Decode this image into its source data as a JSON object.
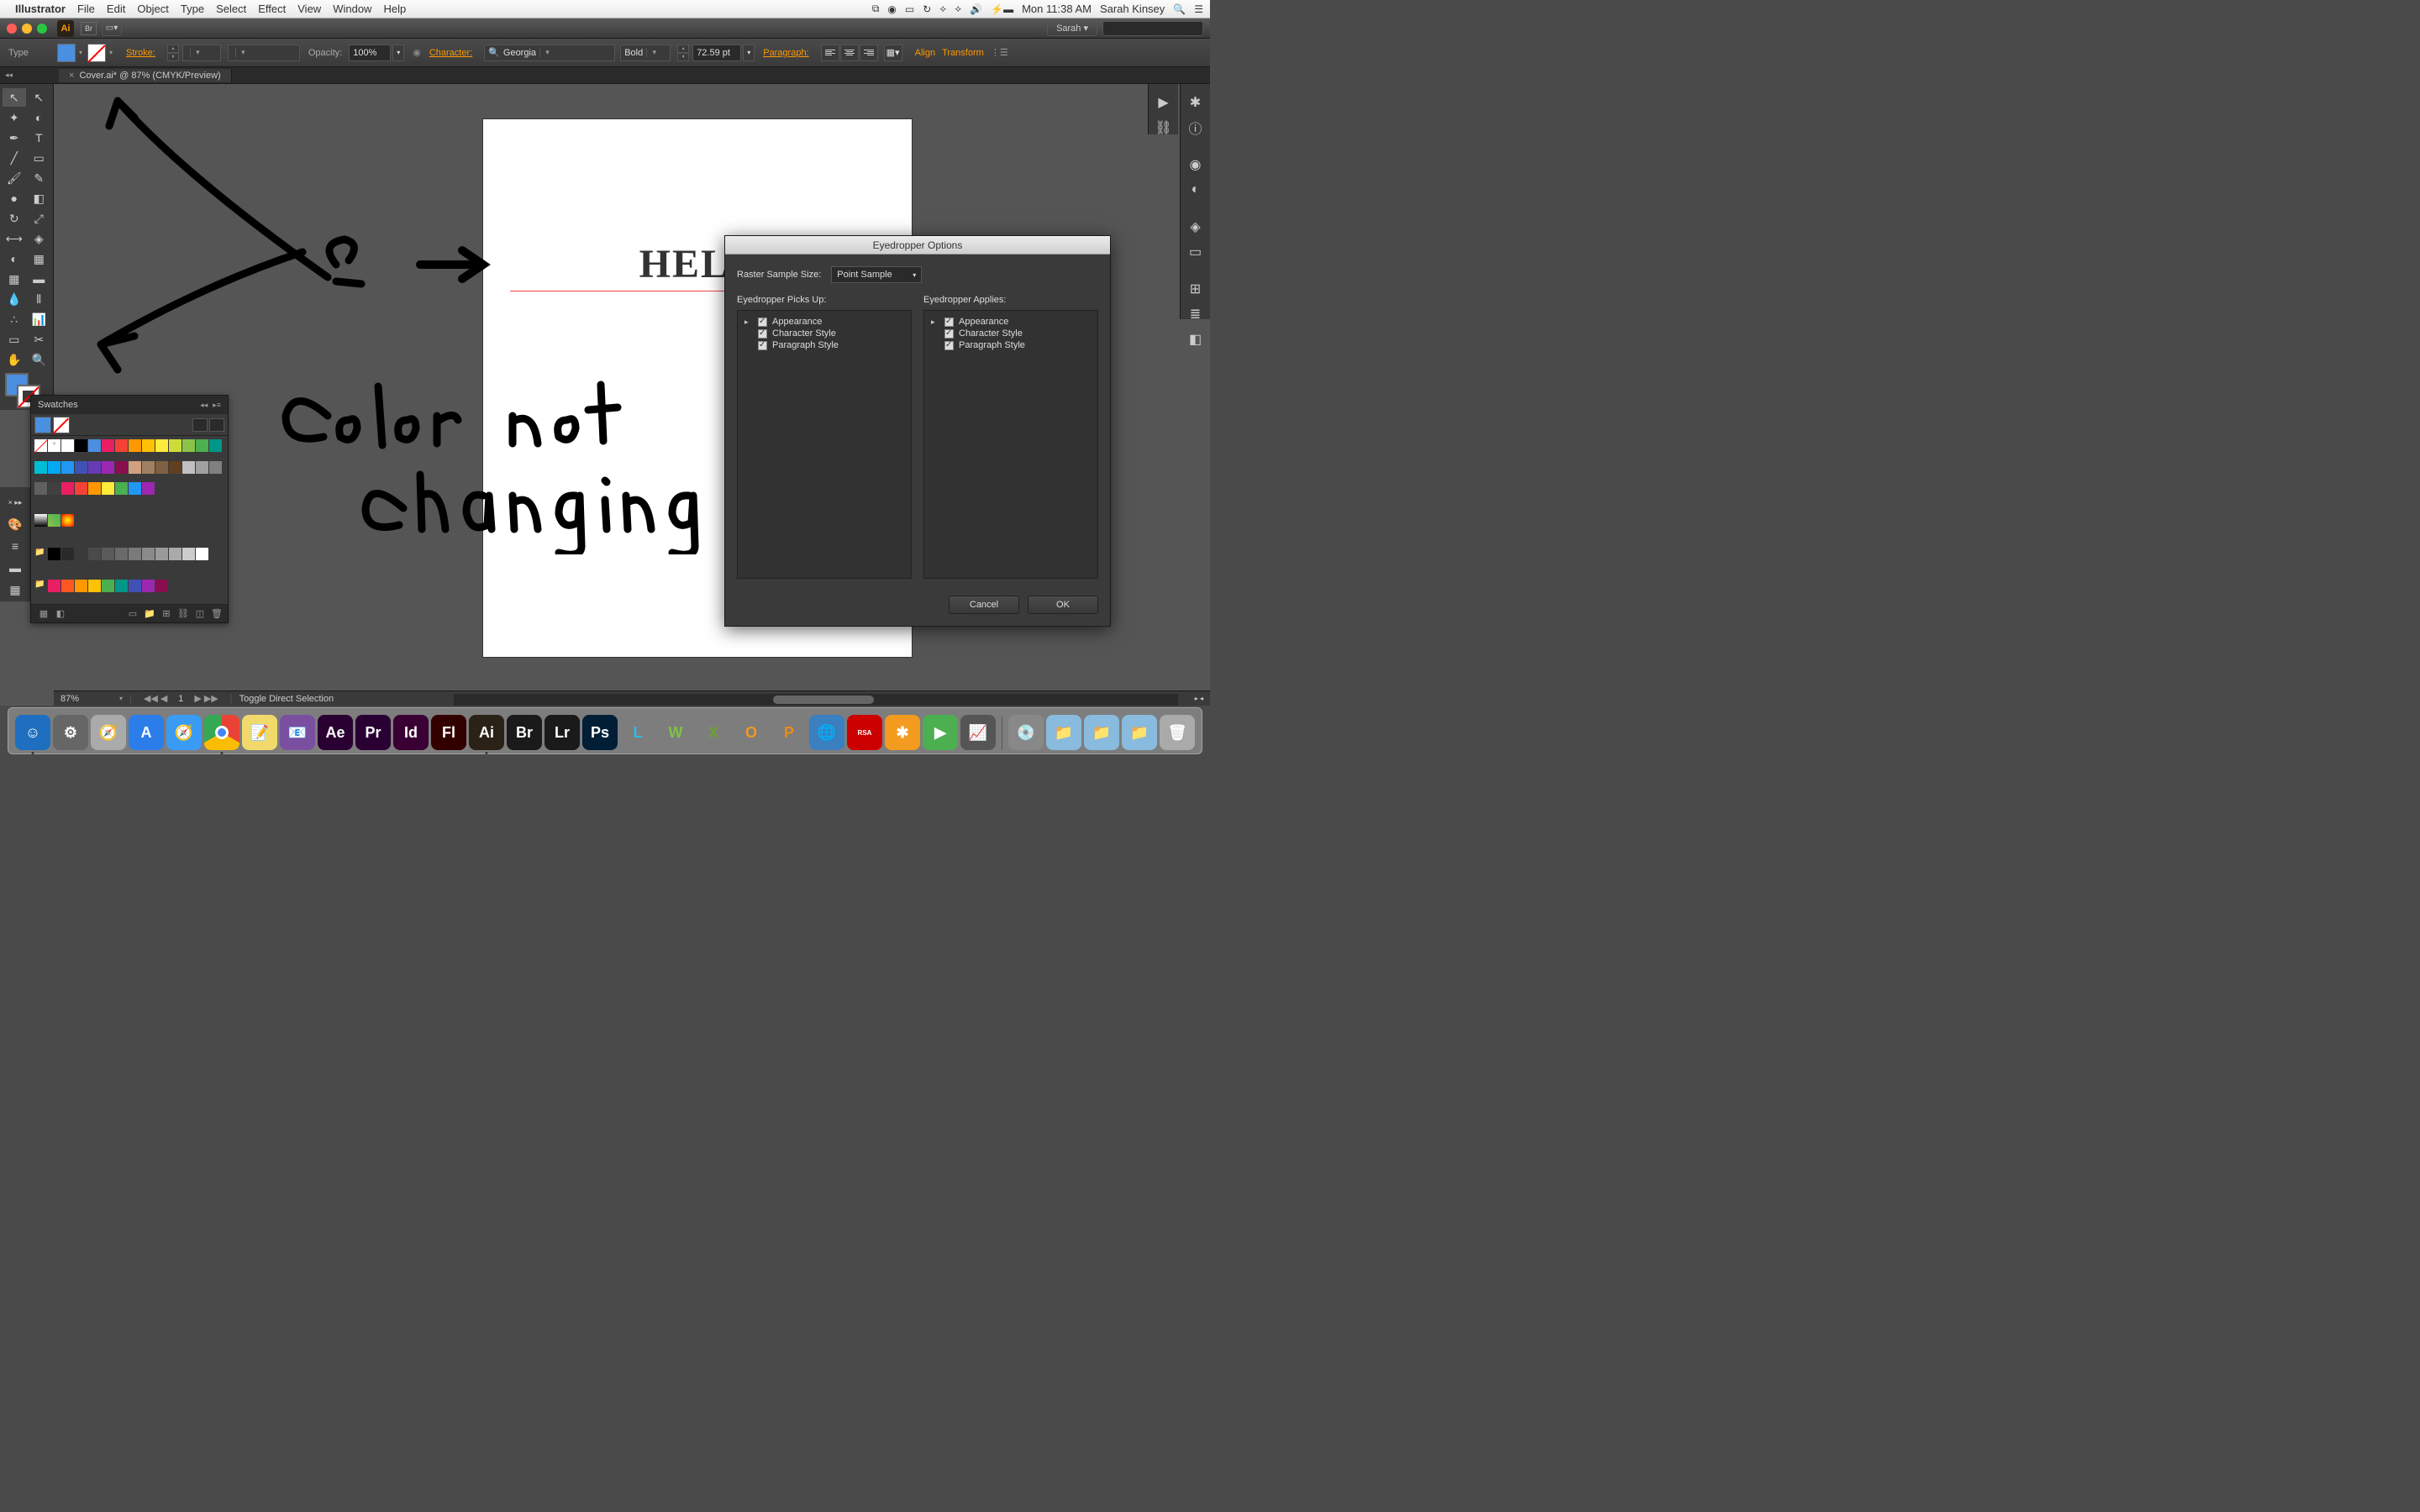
{
  "menubar": {
    "app": "Illustrator",
    "items": [
      "File",
      "Edit",
      "Object",
      "Type",
      "Select",
      "Effect",
      "View",
      "Window",
      "Help"
    ],
    "clock": "Mon 11:38 AM",
    "user": "Sarah Kinsey"
  },
  "titlebar": {
    "user_menu": "Sarah"
  },
  "controlbar": {
    "mode": "Type",
    "stroke_label": "Stroke:",
    "stroke_value": "",
    "opacity_label": "Opacity:",
    "opacity_value": "100%",
    "character_label": "Character:",
    "font_family": "Georgia",
    "font_style": "Bold",
    "font_size": "72.59 pt",
    "paragraph_label": "Paragraph:",
    "align_label": "Align",
    "transform_label": "Transform"
  },
  "document": {
    "tab": "Cover.ai* @ 87% (CMYK/Preview)",
    "artboard_text": "HELP"
  },
  "annotation": {
    "line1": "Color not",
    "line2": "changing",
    "q": "?"
  },
  "swatches": {
    "title": "Swatches",
    "colors": [
      "#ffffff",
      "#000000",
      "#4a8fe0",
      "#e91e63",
      "#f44336",
      "#ff9800",
      "#ffc107",
      "#ffeb3b",
      "#cddc39",
      "#8bc34a",
      "#4caf50",
      "#009688",
      "#00bcd4",
      "#03a9f4",
      "#2196f3",
      "#3f51b5",
      "#673ab7",
      "#9c27b0",
      "#880e4f",
      "#d0a080",
      "#a08060",
      "#806040",
      "#604020",
      "#c0c0c0",
      "#a0a0a0",
      "#808080",
      "#606060",
      "#404040",
      "#e91e63",
      "#f44336",
      "#ff9800",
      "#ffeb3b",
      "#4caf50",
      "#2196f3",
      "#9c27b0"
    ],
    "row3": [
      "#000000",
      "#2a2a2a",
      "#3a3a3a",
      "#4a4a4a",
      "#5a5a5a",
      "#6a6a6a",
      "#7a7a7a",
      "#8a8a8a",
      "#9a9a9a",
      "#aaaaaa",
      "#cccccc",
      "#ffffff"
    ],
    "row4": [
      "#e91e63",
      "#ff5722",
      "#ff9800",
      "#ffc107",
      "#4caf50",
      "#009688",
      "#3f51b5",
      "#9c27b0",
      "#880e4f"
    ]
  },
  "eyedropper": {
    "title": "Eyedropper Options",
    "sample_label": "Raster Sample Size:",
    "sample_value": "Point Sample",
    "picks_label": "Eyedropper Picks Up:",
    "applies_label": "Eyedropper Applies:",
    "items": [
      "Appearance",
      "Character Style",
      "Paragraph Style"
    ],
    "cancel": "Cancel",
    "ok": "OK"
  },
  "statusbar": {
    "zoom": "87%",
    "text": "Toggle Direct Selection"
  },
  "dock": {
    "apps": [
      {
        "bg": "#1e6fbf",
        "txt": "☺",
        "name": "finder"
      },
      {
        "bg": "#666",
        "txt": "⚙",
        "name": "sysprefs"
      },
      {
        "bg": "#aaa",
        "txt": "🧭",
        "name": "safari-old"
      },
      {
        "bg": "#2b7de9",
        "txt": "A",
        "name": "appstore"
      },
      {
        "bg": "#3a9bf4",
        "txt": "🧭",
        "name": "safari"
      },
      {
        "bg": "#fff",
        "txt": "",
        "name": "chrome"
      },
      {
        "bg": "#f2d96b",
        "txt": "📝",
        "name": "stickies"
      },
      {
        "bg": "#7a4fa0",
        "txt": "📧",
        "name": "mail"
      },
      {
        "bg": "#2a0033",
        "txt": "Ae",
        "name": "aftereffects"
      },
      {
        "bg": "#2a0033",
        "txt": "Pr",
        "name": "premiere"
      },
      {
        "bg": "#3a0033",
        "txt": "Id",
        "name": "indesign"
      },
      {
        "bg": "#330000",
        "txt": "Fl",
        "name": "flash"
      },
      {
        "bg": "#2a2217",
        "txt": "Ai",
        "name": "illustrator"
      },
      {
        "bg": "#1a1a1a",
        "txt": "Br",
        "name": "bridge"
      },
      {
        "bg": "#1a1a1a",
        "txt": "Lr",
        "name": "lightroom"
      },
      {
        "bg": "#001e36",
        "txt": "Ps",
        "name": "photoshop"
      },
      {
        "bg": "transparent",
        "txt": "L",
        "name": "l-app",
        "color": "#2bbde8"
      },
      {
        "bg": "transparent",
        "txt": "W",
        "name": "w-app",
        "color": "#7fc241"
      },
      {
        "bg": "transparent",
        "txt": "X",
        "name": "x-app",
        "color": "#6fa030"
      },
      {
        "bg": "transparent",
        "txt": "O",
        "name": "o-app",
        "color": "#f29b1e"
      },
      {
        "bg": "transparent",
        "txt": "P",
        "name": "p-app",
        "color": "#e98b1a"
      },
      {
        "bg": "#3a7fbf",
        "txt": "🌐",
        "name": "globe"
      },
      {
        "bg": "#c00",
        "txt": "RSA",
        "name": "securid",
        "fs": "8px"
      },
      {
        "bg": "#f29b1e",
        "txt": "✱",
        "name": "star-app"
      },
      {
        "bg": "#4caf50",
        "txt": "▶",
        "name": "play"
      },
      {
        "bg": "#555",
        "txt": "📈",
        "name": "monitor"
      },
      {
        "bg": "#888",
        "txt": "💿",
        "name": "dvd"
      },
      {
        "bg": "#8bd",
        "txt": "📁",
        "name": "folder1"
      },
      {
        "bg": "#8bd",
        "txt": "📁",
        "name": "folder2"
      },
      {
        "bg": "#8bd",
        "txt": "📁",
        "name": "folder3"
      },
      {
        "bg": "#aaa",
        "txt": "🗑",
        "name": "trash"
      }
    ]
  }
}
